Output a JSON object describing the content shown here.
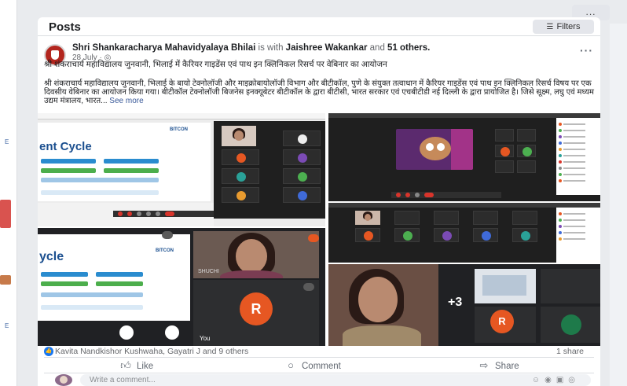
{
  "top_menu": {
    "label": "..."
  },
  "posts": {
    "title": "Posts",
    "filters_label": "Filters"
  },
  "post": {
    "author": "Shri Shankaracharya Mahavidyalaya Bhilai",
    "with_text": "is with",
    "tagged": "Jaishree Wakankar",
    "and_text": "and",
    "others": "51 others.",
    "date": "28 July",
    "privacy_icon": "globe-icon",
    "title_text": "श्री शंकराचार्य महाविद्यालय जुनवानी, भिलाई में कैरियर गाइडेंस एवं पाथ इन क्लिनिकल रिसर्च पर वेबिनार का आयोजन",
    "body_text": "श्री शंकराचार्य महाविद्यालय जुनवानी, भिलाई के बायो टेक्नोलॉजी और माइक्रोबायोलॉजी विभाग और बीटीकॉल, पुणे के संयुक्त तत्वाधान में कैरियर गाइडेंस एवं पाथ इन क्लिनिकल रिसर्च विषय पर एक दिवसीय वेबिनार का आयोजन किया गया। बीटीकॉल टेक्नोलॉजी बिजनेस इनक्यूबेटर बीटीकॉल के द्वारा बीटीसी, भारत सरकार एवं एचबीटीडी नई दिल्ली के द्वारा प्रायोजित है। जिसे सूक्ष्म, लघु एवं मध्यम उद्यम मंत्रालय, भारत...",
    "see_more": "See more"
  },
  "screens": {
    "slide_title_1": "ent Cycle",
    "slide_title_2": "ycle",
    "brand": "BITCON",
    "tile_name_shuchi": "SHUCHI",
    "you_label": "You",
    "avatar_letter": "R",
    "overflow_count": "+3"
  },
  "engagement": {
    "reactors": "Kavita Nandkishor Kushwaha, Gayatri J and 9 others",
    "shares": "1 share"
  },
  "actions": {
    "like": "Like",
    "comment": "Comment",
    "share": "Share"
  },
  "comment_box": {
    "placeholder": "Write a comment..."
  },
  "colors": {
    "brand_blue": "#1877f2",
    "avatar_red": "#e65722",
    "page_bg": "#e9ebee"
  }
}
